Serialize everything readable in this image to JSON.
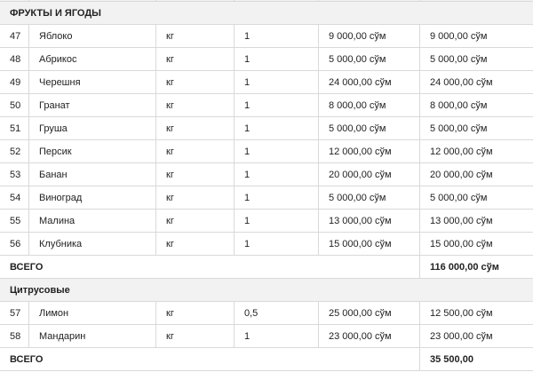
{
  "sections": [
    {
      "title": "ФРУКТЫ И ЯГОДЫ",
      "rows": [
        {
          "no": "47",
          "name": "Яблоко",
          "unit": "кг",
          "qty": "1",
          "price": "9 000,00 сўм",
          "sum": "9 000,00 сўм"
        },
        {
          "no": "48",
          "name": "Абрикос",
          "unit": "кг",
          "qty": "1",
          "price": "5 000,00 сўм",
          "sum": "5 000,00 сўм"
        },
        {
          "no": "49",
          "name": "Черешня",
          "unit": "кг",
          "qty": "1",
          "price": "24 000,00 сўм",
          "sum": "24 000,00 сўм"
        },
        {
          "no": "50",
          "name": "Гранат",
          "unit": "кг",
          "qty": "1",
          "price": "8 000,00 сўм",
          "sum": "8 000,00 сўм"
        },
        {
          "no": "51",
          "name": "Груша",
          "unit": "кг",
          "qty": "1",
          "price": "5 000,00 сўм",
          "sum": "5 000,00 сўм"
        },
        {
          "no": "52",
          "name": "Персик",
          "unit": "кг",
          "qty": "1",
          "price": "12 000,00 сўм",
          "sum": "12 000,00 сўм"
        },
        {
          "no": "53",
          "name": "Банан",
          "unit": "кг",
          "qty": "1",
          "price": "20 000,00 сўм",
          "sum": "20 000,00 сўм"
        },
        {
          "no": "54",
          "name": "Виноград",
          "unit": "кг",
          "qty": "1",
          "price": "5 000,00 сўм",
          "sum": "5 000,00 сўм"
        },
        {
          "no": "55",
          "name": "Малина",
          "unit": "кг",
          "qty": "1",
          "price": "13 000,00 сўм",
          "sum": "13 000,00 сўм"
        },
        {
          "no": "56",
          "name": "Клубника",
          "unit": "кг",
          "qty": "1",
          "price": "15 000,00 сўм",
          "sum": "15 000,00 сўм"
        }
      ],
      "total_label": "ВСЕГО",
      "total_value": "116 000,00 сўм"
    },
    {
      "title": "Цитрусовые",
      "rows": [
        {
          "no": "57",
          "name": "Лимон",
          "unit": "кг",
          "qty": "0,5",
          "price": "25 000,00 сўм",
          "sum": "12 500,00 сўм"
        },
        {
          "no": "58",
          "name": "Мандарин",
          "unit": "кг",
          "qty": "1",
          "price": "23 000,00 сўм",
          "sum": "23 000,00 сўм"
        }
      ],
      "total_label": "ВСЕГО",
      "total_value": "35 500,00"
    }
  ]
}
